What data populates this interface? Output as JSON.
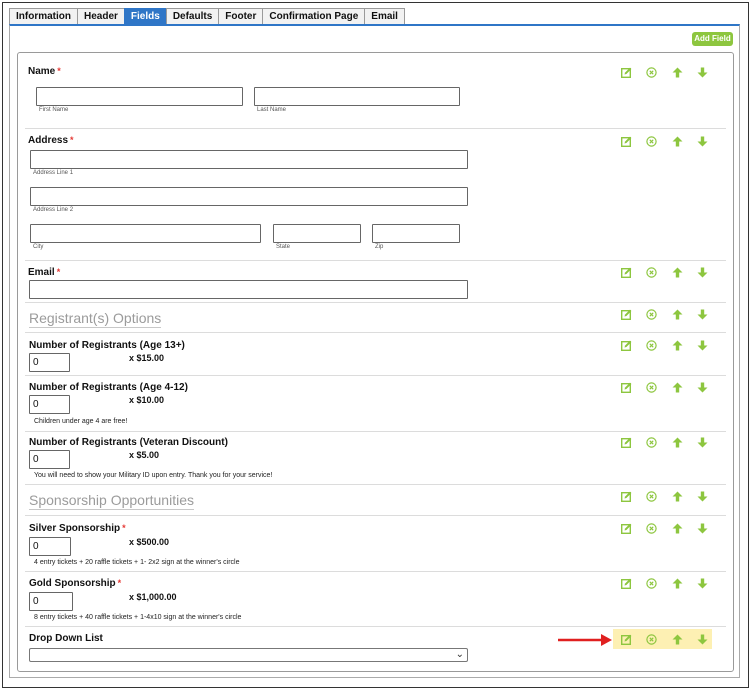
{
  "tabs": [
    "Information",
    "Header",
    "Fields",
    "Defaults",
    "Footer",
    "Confirmation Page",
    "Email"
  ],
  "active_tab": "Fields",
  "add_field_label": "Add Field",
  "required_marker": "*",
  "colors": {
    "accent": "#2f76c7",
    "action_green": "#8dc63f",
    "required": "#e53935",
    "highlight": "#fdf0b3",
    "arrow": "#e02020"
  },
  "icons": {
    "edit": "edit-icon",
    "delete": "delete-icon",
    "move_up": "arrow-up-icon",
    "move_down": "arrow-down-icon"
  },
  "fields": {
    "name": {
      "label": "Name",
      "first_sub": "First Name",
      "last_sub": "Last Name"
    },
    "address": {
      "label": "Address",
      "line1_sub": "Address Line 1",
      "line2_sub": "Address Line 2",
      "city_sub": "City",
      "state_sub": "State",
      "zip_sub": "Zip"
    },
    "email": {
      "label": "Email"
    },
    "registrant_options": {
      "title": "Registrant(s) Options"
    },
    "reg_13": {
      "label": "Number of Registrants (Age 13+)",
      "value": "0",
      "price": "x $15.00"
    },
    "reg_4_12": {
      "label": "Number of Registrants (Age 4-12)",
      "value": "0",
      "price": "x $10.00",
      "note": "Children under age 4 are free!"
    },
    "reg_veteran": {
      "label": "Number of Registrants (Veteran Discount)",
      "value": "0",
      "price": "x $5.00",
      "note": "You will need to show your Military ID upon entry. Thank you for your service!"
    },
    "sponsorship": {
      "title": "Sponsorship Opportunities"
    },
    "silver": {
      "label": "Silver Sponsorship",
      "value": "0",
      "price": "x $500.00",
      "note": "4 entry tickets + 20 raffle tickets + 1- 2x2 sign at the winner's circle"
    },
    "gold": {
      "label": "Gold Sponsorship",
      "value": "0",
      "price": "x $1,000.00",
      "note": "8 entry tickets + 40 raffle tickets + 1-4x10 sign at the winner's circle"
    },
    "dropdown": {
      "label": "Drop Down List",
      "value": ""
    }
  }
}
